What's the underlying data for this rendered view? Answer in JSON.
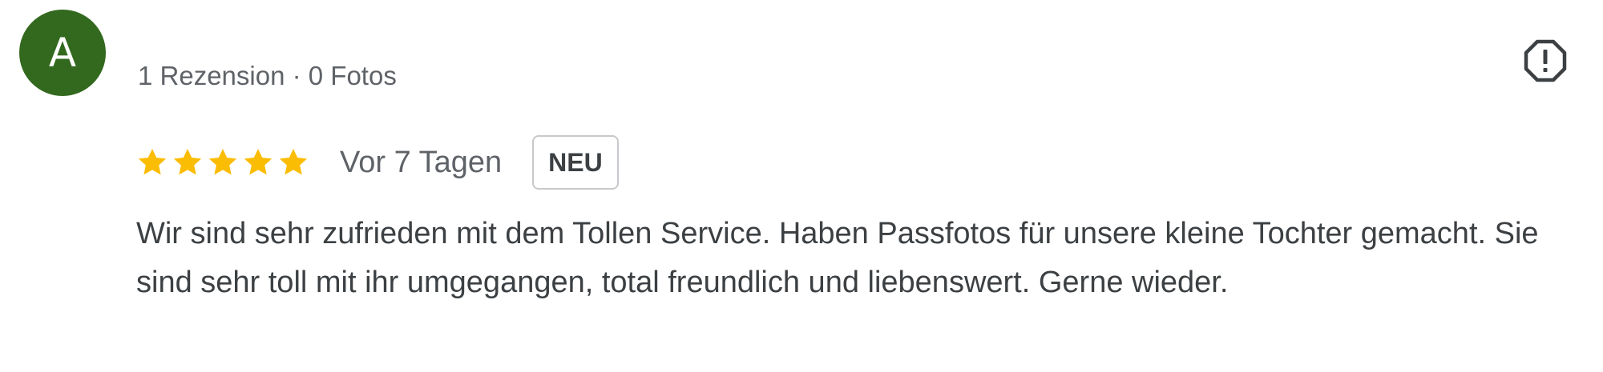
{
  "reviewer": {
    "initial": "A",
    "avatar_color": "#33691e",
    "meta": "1 Rezension · 0 Fotos"
  },
  "report_button": {
    "icon": "report-icon"
  },
  "rating": {
    "stars": 5,
    "max_stars": 5,
    "star_color": "#fbbc04"
  },
  "date": "Vor 7 Tagen",
  "badge": "NEU",
  "review_text": "Wir sind sehr zufrieden mit dem Tollen Service. Haben Passfotos für unsere kleine Tochter gemacht. Sie sind sehr toll mit ihr umgegangen, total freundlich und liebenswert. Gerne wieder."
}
